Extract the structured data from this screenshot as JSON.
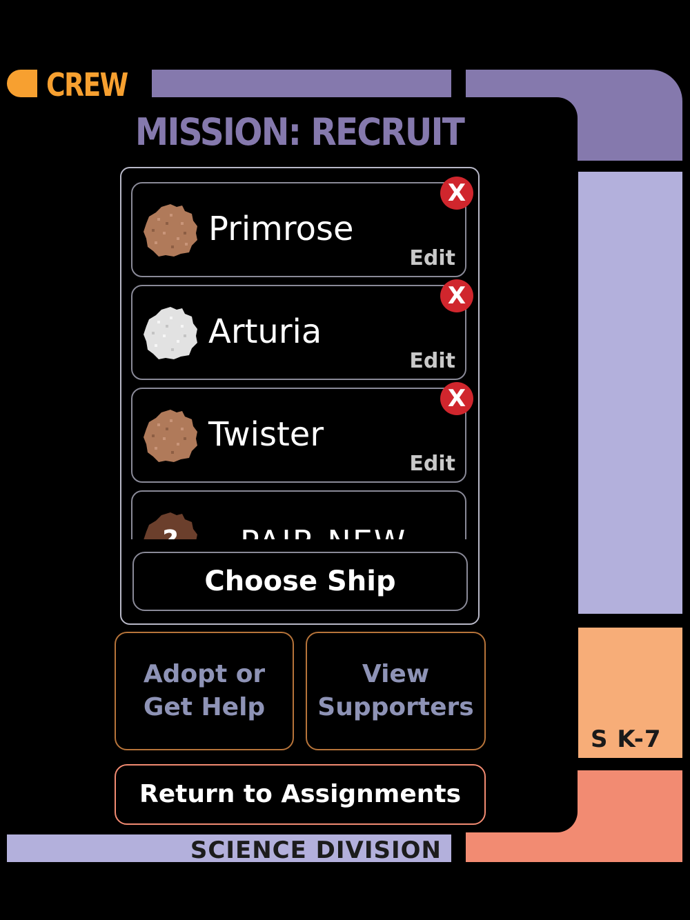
{
  "header": {
    "section_title": "CREW",
    "mission_title": "MISSION: RECRUIT"
  },
  "crew": [
    {
      "name": "Primrose",
      "edit_label": "Edit",
      "remove_label": "X",
      "avatar_color": "#b07a5a"
    },
    {
      "name": "Arturia",
      "edit_label": "Edit",
      "remove_label": "X",
      "avatar_color": "#e2e2e2"
    },
    {
      "name": "Twister",
      "edit_label": "Edit",
      "remove_label": "X",
      "avatar_color": "#b07a5a"
    }
  ],
  "pair_new": {
    "label": "PAIR NEW",
    "avatar_badge": "?",
    "avatar_color": "#6b3f2c"
  },
  "buttons": {
    "choose_ship": "Choose Ship",
    "adopt_line1": "Adopt or",
    "adopt_line2": "Get Help",
    "view_line1": "View",
    "view_line2": "Supporters",
    "return": "Return to Assignments"
  },
  "footer": {
    "division": "SCIENCE DIVISION",
    "station_code": "S K-7"
  },
  "colors": {
    "lcars_orange": "#f7a030",
    "lcars_purple": "#8579ad",
    "lcars_lavender": "#b3b0dc",
    "lcars_peach": "#f7ad78",
    "lcars_salmon": "#f28b72",
    "remove_red": "#d0262d"
  }
}
